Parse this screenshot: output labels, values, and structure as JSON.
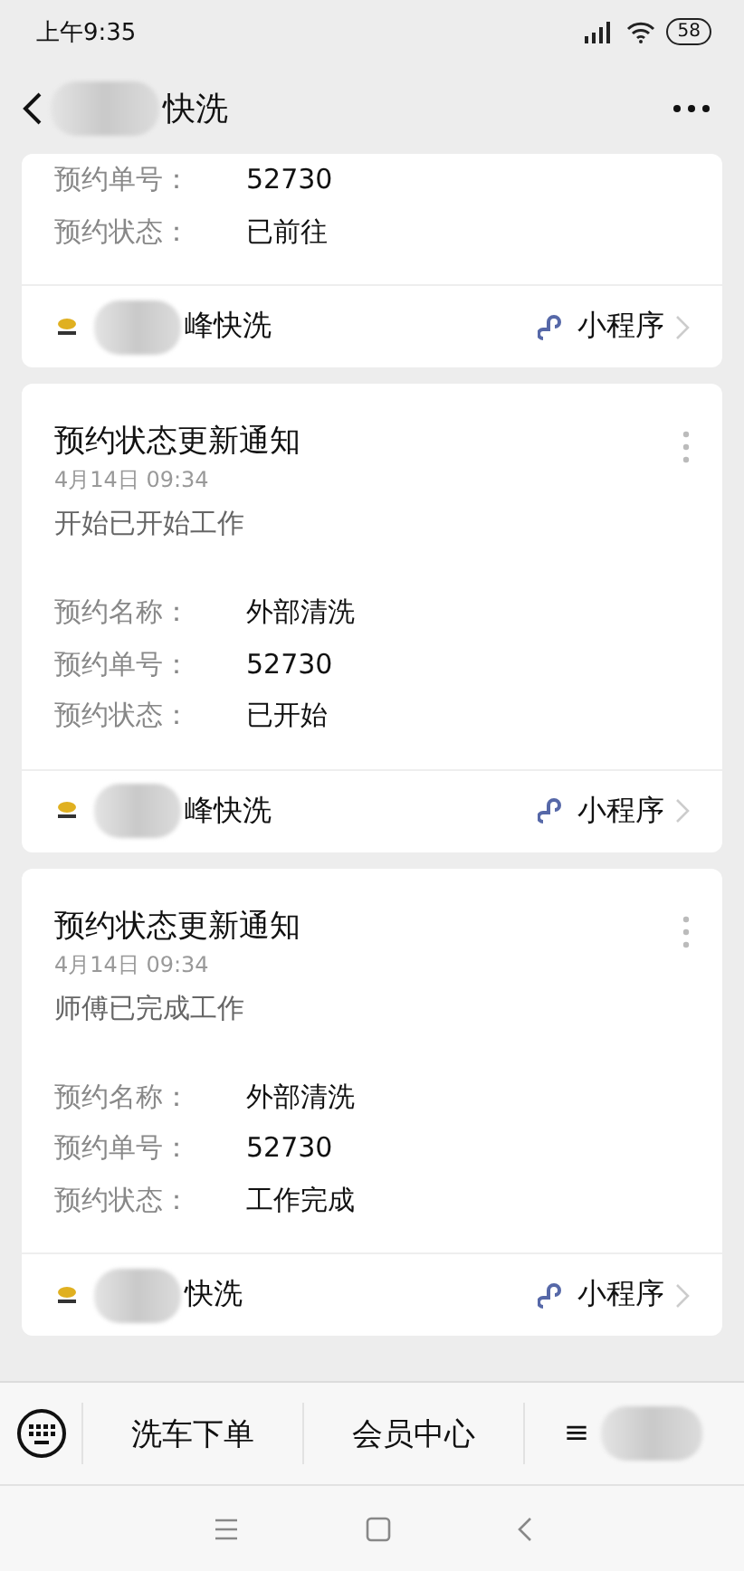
{
  "status_bar": {
    "time": "上午9:35",
    "battery": "58"
  },
  "header": {
    "title": "快洗"
  },
  "messages": [
    {
      "fields": [
        {
          "label": "预约单号：",
          "value": "52730"
        },
        {
          "label": "预约状态：",
          "value": "已前往"
        }
      ],
      "source": {
        "name": "峰快洗",
        "link": "小程序"
      }
    },
    {
      "title": "预约状态更新通知",
      "date": "4月14日  09:34",
      "description": "开始已开始工作",
      "fields": [
        {
          "label": "预约名称：",
          "value": "外部清洗"
        },
        {
          "label": "预约单号：",
          "value": "52730"
        },
        {
          "label": "预约状态：",
          "value": "已开始"
        }
      ],
      "source": {
        "name": "峰快洗",
        "link": "小程序"
      }
    },
    {
      "title": "预约状态更新通知",
      "date": "4月14日  09:34",
      "description": "师傅已完成工作",
      "fields": [
        {
          "label": "预约名称：",
          "value": "外部清洗"
        },
        {
          "label": "预约单号：",
          "value": "52730"
        },
        {
          "label": "预约状态：",
          "value": "工作完成"
        }
      ],
      "source": {
        "name": "快洗",
        "link": "小程序"
      }
    }
  ],
  "menu": [
    {
      "label": "洗车下单"
    },
    {
      "label": "会员中心"
    },
    {
      "label": "≡"
    }
  ]
}
